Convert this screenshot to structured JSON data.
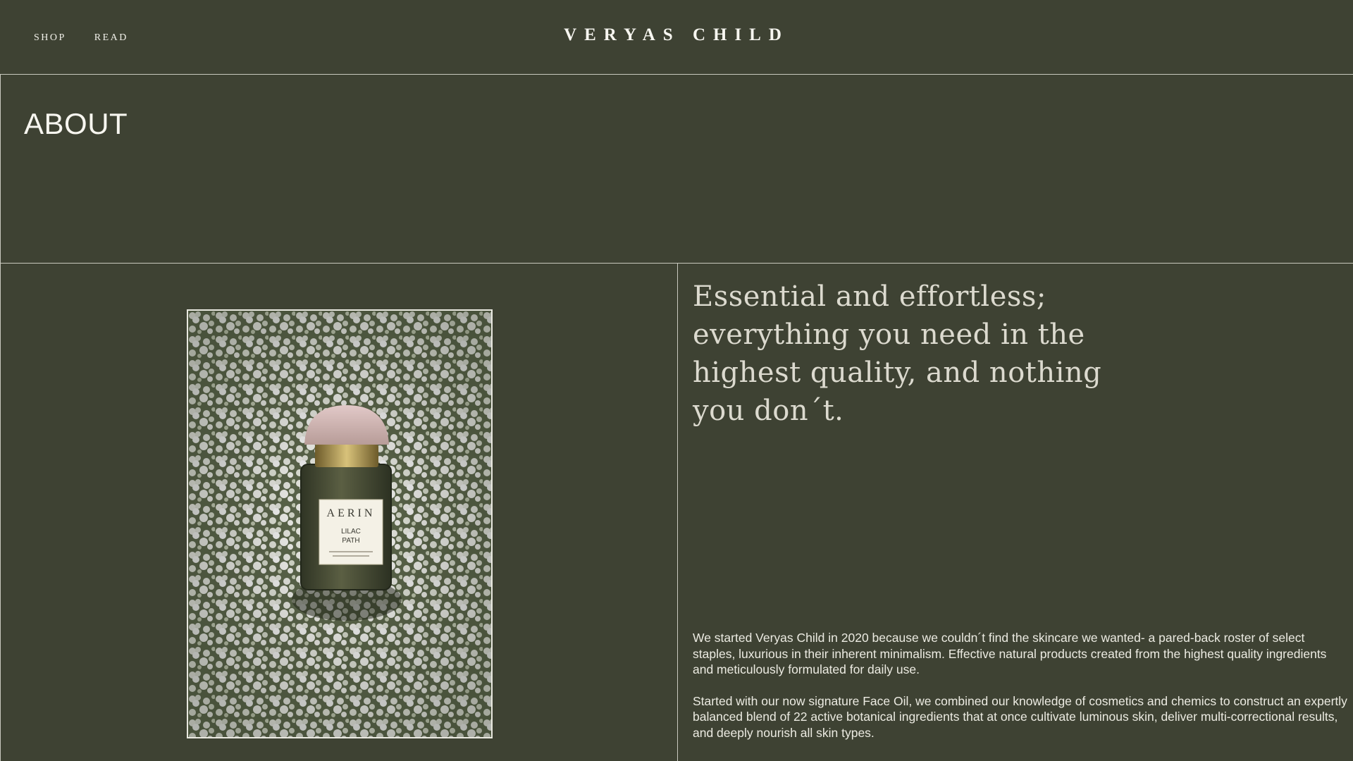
{
  "header": {
    "nav": [
      {
        "label": "SHOP"
      },
      {
        "label": "READ"
      }
    ],
    "logo": "VERYAS CHILD"
  },
  "hero": {
    "title": "ABOUT"
  },
  "product_image": {
    "alt": "AERIN Lilac Path eau de parfum bottle resting on white flowers",
    "bottle_brand": "AERIN",
    "bottle_name_line1": "LILAC",
    "bottle_name_line2": "PATH"
  },
  "content": {
    "tagline": "Essential and effortless; everything you need in the highest quality, and nothing you don´t.",
    "paragraphs": [
      "We started Veryas Child in 2020 because we couldn´t find the skincare we wanted- a pared-back roster of select staples, luxurious in their inherent minimalism. Effective natural products created from the highest quality ingredients and meticulously formulated for daily use.",
      "Started with our now signature Face Oil, we combined our knowledge of cosmetics and chemics to construct an expertly balanced blend of 22 active botanical ingredients that at once cultivate luminous skin, deliver multi-correctional results, and deeply nourish all skin types."
    ]
  }
}
